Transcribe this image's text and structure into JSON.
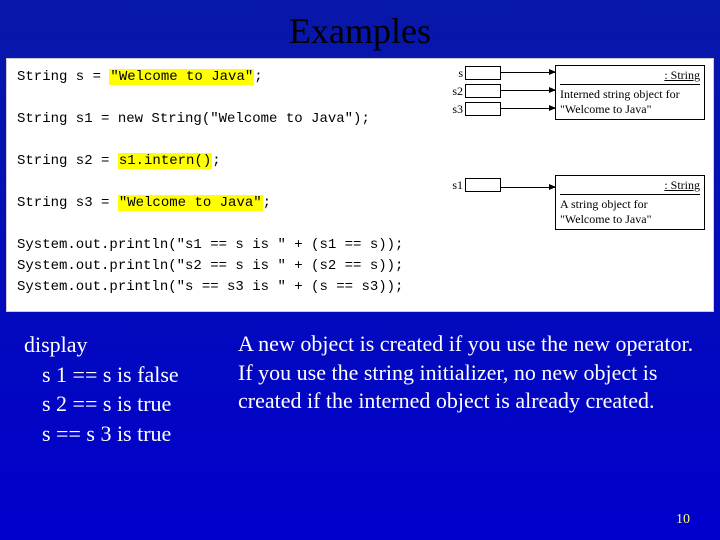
{
  "title": "Examples",
  "code": {
    "l1a": "String s = ",
    "l1b": "\"Welcome to Java\"",
    "l1c": ";",
    "l2": "String s1 = new String(\"Welcome to Java\");",
    "l3a": "String s2 = ",
    "l3b": "s1.intern()",
    "l3c": ";",
    "l4a": "String s3 = ",
    "l4b": "\"Welcome to Java\"",
    "l4c": ";",
    "l5": "System.out.println(\"s1 == s is \" + (s1 == s));",
    "l6": "System.out.println(\"s2 == s is \" + (s2 == s));",
    "l7": "System.out.println(\"s == s3 is \" + (s == s3));"
  },
  "diagram": {
    "var_s": "s",
    "var_s2": "s2",
    "var_s3": "s3",
    "var_s1": "s1",
    "obj1_header": ": String",
    "obj1_body": "Interned string object for \"Welcome to Java\"",
    "obj2_header": ": String",
    "obj2_body": "A string object for \"Welcome to Java\""
  },
  "display": {
    "heading": "display",
    "r1": "s 1 == s is false",
    "r2": "s 2 == s is true",
    "r3": "s == s 3 is true"
  },
  "explain": {
    "p1": "A new object is created if you use the new operator.",
    "p2": "If you use the string initializer, no new object is created if the interned object is already created."
  },
  "page": "10"
}
